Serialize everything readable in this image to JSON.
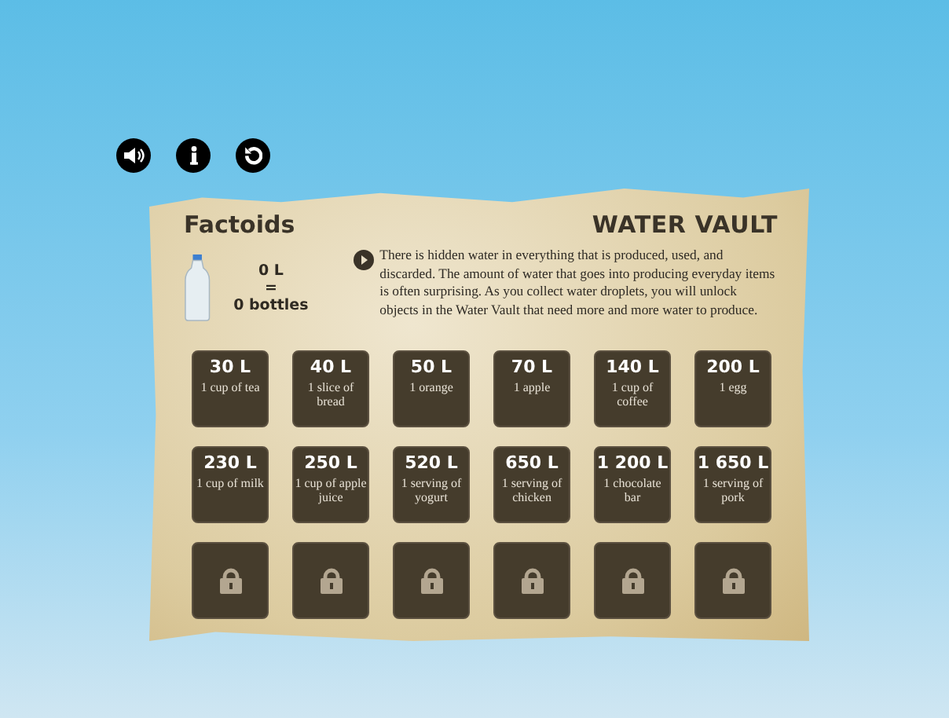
{
  "toolbar": {
    "buttons": [
      {
        "kind": "sound"
      },
      {
        "kind": "info"
      },
      {
        "kind": "restart"
      }
    ]
  },
  "panel": {
    "title": "Factoids",
    "heading": "WATER VAULT",
    "counter": {
      "liters": "0 L",
      "equals": "=",
      "bottles": "0 bottles"
    },
    "description": "There is hidden water in everything that is produced, used, and discarded. The amount of water that goes into producing everyday items is often surprising. As you collect water droplets, you will unlock objects in the Water Vault that need more and more water to produce.",
    "tiles": [
      {
        "kind": "unlocked",
        "amount": "30 L",
        "item": "1 cup of tea"
      },
      {
        "kind": "unlocked",
        "amount": "40 L",
        "item": "1 slice of bread"
      },
      {
        "kind": "unlocked",
        "amount": "50 L",
        "item": "1 orange"
      },
      {
        "kind": "unlocked",
        "amount": "70 L",
        "item": "1 apple"
      },
      {
        "kind": "unlocked",
        "amount": "140 L",
        "item": "1 cup of coffee"
      },
      {
        "kind": "unlocked",
        "amount": "200 L",
        "item": "1 egg"
      },
      {
        "kind": "unlocked",
        "amount": "230 L",
        "item": "1 cup of milk"
      },
      {
        "kind": "unlocked",
        "amount": "250 L",
        "item": "1 cup of apple juice"
      },
      {
        "kind": "unlocked",
        "amount": "520 L",
        "item": "1 serving of yogurt"
      },
      {
        "kind": "unlocked",
        "amount": "650 L",
        "item": "1 serving of chicken"
      },
      {
        "kind": "unlocked",
        "amount": "1 200 L",
        "item": "1 chocolate bar"
      },
      {
        "kind": "unlocked",
        "amount": "1 650 L",
        "item": "1 serving of pork"
      },
      {
        "kind": "locked"
      },
      {
        "kind": "locked"
      },
      {
        "kind": "locked"
      },
      {
        "kind": "locked"
      },
      {
        "kind": "locked"
      },
      {
        "kind": "locked"
      }
    ]
  }
}
